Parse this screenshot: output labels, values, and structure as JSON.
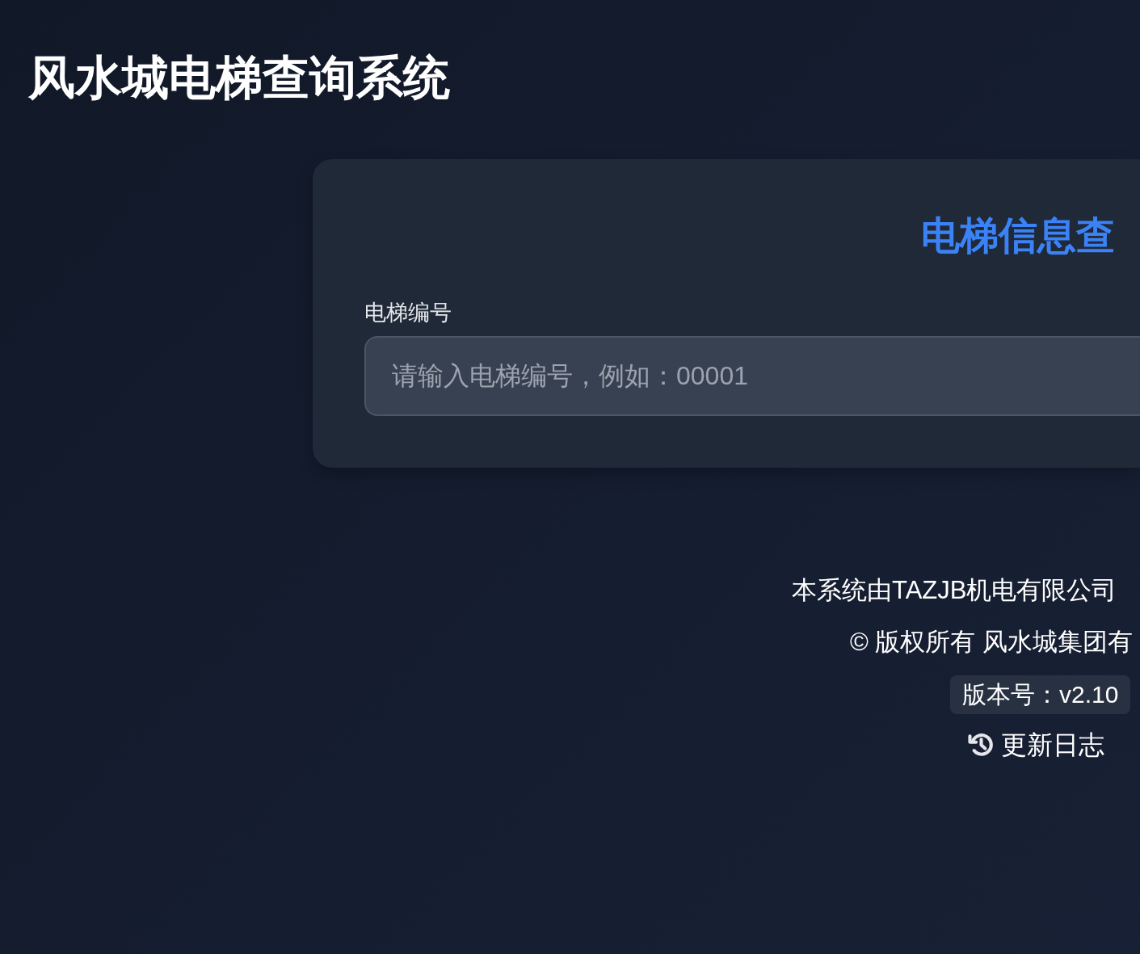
{
  "header": {
    "title": "风水城电梯查询系统"
  },
  "card": {
    "title": "电梯信息查",
    "field": {
      "label": "电梯编号",
      "placeholder": "请输入电梯编号，例如：00001"
    }
  },
  "footer": {
    "provider_note": "本系统由TAZJB机电有限公司",
    "copyright": "© 版权所有 风水城集团有",
    "version": "版本号：v2.10",
    "changelog_link": "更新日志"
  }
}
